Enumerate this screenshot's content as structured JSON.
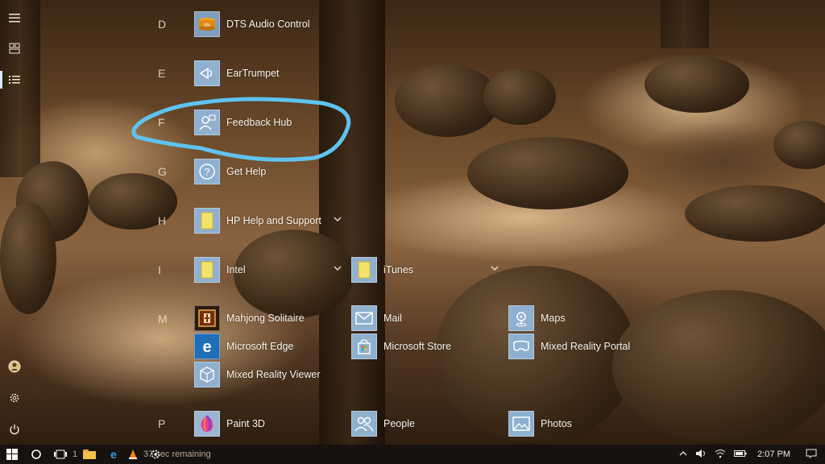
{
  "rail": {
    "items": [
      {
        "icon": "hamburger-menu-icon"
      },
      {
        "icon": "tiles-view-icon"
      },
      {
        "icon": "list-view-icon"
      },
      {
        "icon": "user-avatar-icon"
      },
      {
        "icon": "settings-gear-icon"
      },
      {
        "icon": "power-icon"
      }
    ]
  },
  "apps": {
    "letters": [
      "D",
      "E",
      "F",
      "G",
      "H",
      "I",
      "M",
      "P"
    ],
    "items": [
      {
        "label": "DTS Audio Control",
        "icon": "dts-audio-icon"
      },
      {
        "label": "EarTrumpet",
        "icon": "eartrumpet-icon"
      },
      {
        "label": "Feedback Hub",
        "icon": "feedback-hub-icon"
      },
      {
        "label": "Get Help",
        "icon": "get-help-icon"
      },
      {
        "label": "HP Help and Support",
        "icon": "folder-icon"
      },
      {
        "label": "Intel",
        "icon": "folder-icon"
      },
      {
        "label": "iTunes",
        "icon": "folder-icon"
      },
      {
        "label": "Mahjong Solitaire",
        "icon": "mahjong-icon"
      },
      {
        "label": "Mail",
        "icon": "mail-icon"
      },
      {
        "label": "Maps",
        "icon": "maps-icon"
      },
      {
        "label": "Microsoft Edge",
        "icon": "edge-icon"
      },
      {
        "label": "Microsoft Store",
        "icon": "store-icon"
      },
      {
        "label": "Mixed Reality Portal",
        "icon": "mixed-reality-portal-icon"
      },
      {
        "label": "Mixed Reality Viewer",
        "icon": "mixed-reality-viewer-icon"
      },
      {
        "label": "Paint 3D",
        "icon": "paint-3d-icon"
      },
      {
        "label": "People",
        "icon": "people-icon"
      },
      {
        "label": "Photos",
        "icon": "photos-icon"
      }
    ]
  },
  "taskbar": {
    "progress_text": "37 sec remaining",
    "progress_prefix": "10",
    "clock": "2:07 PM"
  },
  "colors": {
    "tile": "#8fb0cf",
    "highlight_circle": "#5fc3f0",
    "taskbar": "#15120f"
  }
}
